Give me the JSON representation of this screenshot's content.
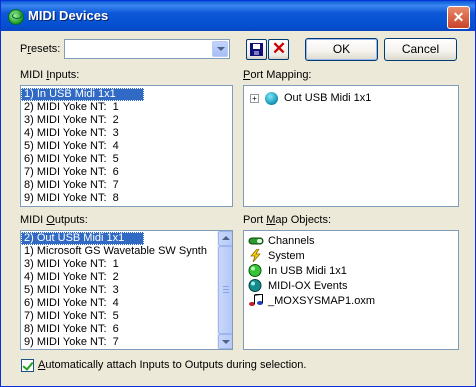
{
  "window": {
    "title": "MIDI Devices",
    "close_label": "✕"
  },
  "presets": {
    "label_pre": "P",
    "label_accel": "r",
    "label_post": "esets:",
    "value": "",
    "ok_label": "OK",
    "cancel_label": "Cancel"
  },
  "midi_inputs": {
    "label_pre": "MIDI ",
    "label_accel": "I",
    "label_post": "nputs:",
    "items": [
      "1) In USB Midi 1x1",
      "2) MIDI Yoke NT:  1",
      "3) MIDI Yoke NT:  2",
      "4) MIDI Yoke NT:  3",
      "5) MIDI Yoke NT:  4",
      "6) MIDI Yoke NT:  5",
      "7) MIDI Yoke NT:  6",
      "8) MIDI Yoke NT:  7",
      "9) MIDI Yoke NT:  8"
    ]
  },
  "port_mapping": {
    "label_pre": "",
    "label_accel": "P",
    "label_post": "ort Mapping:",
    "expander": "+",
    "item": "Out USB Midi 1x1"
  },
  "midi_outputs": {
    "label_pre": "MIDI ",
    "label_accel": "O",
    "label_post": "utputs:",
    "items": [
      "2) Out USB Midi 1x1",
      "1) Microsoft GS Wavetable SW Synth",
      "3) MIDI Yoke NT:  1",
      "4) MIDI Yoke NT:  2",
      "5) MIDI Yoke NT:  3",
      "6) MIDI Yoke NT:  4",
      "7) MIDI Yoke NT:  5",
      "8) MIDI Yoke NT:  6",
      "9) MIDI Yoke NT:  7"
    ]
  },
  "port_map_objects": {
    "label_pre": "Port ",
    "label_accel": "M",
    "label_post": "ap Objects:",
    "items": [
      {
        "label": "Channels",
        "icon": "channels-icon"
      },
      {
        "label": "System",
        "icon": "lightning-icon"
      },
      {
        "label": "In USB Midi 1x1",
        "icon": "green-port-icon"
      },
      {
        "label": "MIDI-OX Events",
        "icon": "teal-port-icon"
      },
      {
        "label": "_MOXSYSMAP1.oxm",
        "icon": "music-note-icon"
      }
    ]
  },
  "auto_attach": {
    "checked": true,
    "label_pre": "",
    "label_accel": "A",
    "label_post": "utomatically attach Inputs to Outputs during selection."
  }
}
